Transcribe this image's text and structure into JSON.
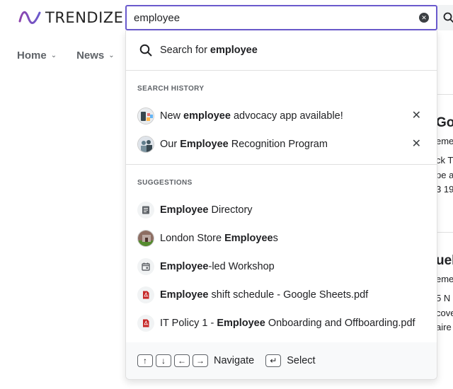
{
  "brand": {
    "name": "TRENDIZE",
    "accent": "#6a5acd"
  },
  "nav": {
    "items": [
      {
        "label": "Home"
      },
      {
        "label": "News"
      }
    ]
  },
  "search": {
    "value": "employee",
    "placeholder": ""
  },
  "dropdown": {
    "search_for": {
      "prefix": "Search for ",
      "term": "employee"
    },
    "history": {
      "label": "SEARCH HISTORY",
      "items": [
        {
          "pre": "New ",
          "hl": "employee",
          "post": " advocacy app available!",
          "icon": "avatar-photo"
        },
        {
          "pre": "Our ",
          "hl": "Employee",
          "post": " Recognition Program",
          "icon": "avatar-photo"
        }
      ]
    },
    "suggestions": {
      "label": "SUGGESTIONS",
      "items": [
        {
          "pre": "",
          "hl": "Employee",
          "post": " Directory",
          "icon": "document-icon"
        },
        {
          "pre": "London Store ",
          "hl": "Employee",
          "post": "s",
          "icon": "avatar-photo"
        },
        {
          "pre": "",
          "hl": "Employee",
          "post": "-led Workshop",
          "icon": "calendar-icon"
        },
        {
          "pre": "",
          "hl": "Employee",
          "post": " shift schedule - Google Sheets.pdf",
          "icon": "pdf-icon"
        },
        {
          "pre": "IT Policy 1 - ",
          "hl": "Employee",
          "post": " Onboarding and Offboarding.pdf",
          "icon": "pdf-icon"
        }
      ]
    },
    "footer": {
      "navigate_label": "Navigate",
      "select_label": "Select"
    }
  },
  "background": {
    "snippets": [
      "Go",
      "eme",
      "ck T",
      "pe a",
      "3 19",
      "uel",
      "eme",
      "5 N",
      "cove",
      "aire"
    ]
  }
}
